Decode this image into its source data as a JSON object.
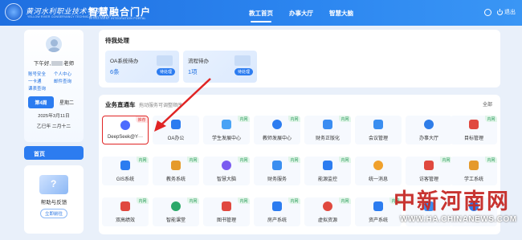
{
  "header": {
    "school_name": "黄河水利职业技术学院",
    "school_name_en": "YELLOW RIVER CONSERVANCY TECHNICAL INSTITUTE",
    "portal_title": "智慧融合门户",
    "portal_subtitle": "INTELLIGENT INTEGRATION PORTAL",
    "tabs": [
      "教工首页",
      "办事大厅",
      "智慧大脑"
    ],
    "active_tab": "教工首页",
    "logout_label": "退出"
  },
  "profile": {
    "greeting_prefix": "下午好,",
    "greeting_suffix": "老师",
    "quick_links": [
      "账号安全",
      "个人中心",
      "一卡通",
      "邮件查询",
      "课表查询"
    ],
    "week_tabs": [
      "第4周",
      "星期二"
    ],
    "date": "2025年3月11日",
    "lunar_date": "乙巳年 二月十二",
    "home_label": "首页"
  },
  "help": {
    "title": "帮助与反馈",
    "button": "立即前往"
  },
  "pending": {
    "title": "待我处理",
    "cards": [
      {
        "name": "OA系统待办",
        "count": "6条",
        "button": "待处理"
      },
      {
        "name": "流程待办",
        "count": "1项",
        "button": "待处理"
      }
    ]
  },
  "services": {
    "title": "业务直通车",
    "hint": "拖动服务可调整顺序",
    "view_all": "全部",
    "rows": [
      [
        {
          "label": "DeepSeek@Y···",
          "badge": "推荐",
          "icon": "deepseek-icon",
          "color": "#4d6bfe",
          "highlight": true
        },
        {
          "label": "OA办公",
          "badge": "",
          "icon": "oa-icon",
          "color": "#2c7cf0"
        },
        {
          "label": "学生发展中心",
          "badge": "内网",
          "icon": "student-dev-icon",
          "color": "#4aa3f5"
        },
        {
          "label": "教师发展中心",
          "badge": "内网",
          "icon": "teacher-dev-icon",
          "color": "#2c7cf0"
        },
        {
          "label": "财务正版化",
          "badge": "内网",
          "icon": "finance-license-icon",
          "color": "#3b8df2"
        },
        {
          "label": "会议管理",
          "badge": "",
          "icon": "meeting-icon",
          "color": "#3a8ef0"
        },
        {
          "label": "办事大厅",
          "badge": "",
          "icon": "service-hall-icon",
          "color": "#2f7de8"
        },
        {
          "label": "目标管理",
          "badge": "内网",
          "icon": "target-icon",
          "color": "#e0493f"
        }
      ],
      [
        {
          "label": "GIS系统",
          "badge": "内网",
          "icon": "gis-icon",
          "color": "#2c7cf0"
        },
        {
          "label": "教务系统",
          "badge": "内网",
          "icon": "academic-icon",
          "color": "#e59a2c"
        },
        {
          "label": "智慧大脑",
          "badge": "内网",
          "icon": "brain-icon",
          "color": "#7b5cf0"
        },
        {
          "label": "财务服务",
          "badge": "内网",
          "icon": "finance-icon",
          "color": "#3a8ef0"
        },
        {
          "label": "能源监控",
          "badge": "内网",
          "icon": "energy-icon",
          "color": "#2c7cf0"
        },
        {
          "label": "统一消息",
          "badge": "",
          "icon": "message-icon",
          "color": "#f0a12c"
        },
        {
          "label": "访客管理",
          "badge": "内网",
          "icon": "visitor-icon",
          "color": "#e0493f"
        },
        {
          "label": "学工系统",
          "badge": "内网",
          "icon": "student-affairs-icon",
          "color": "#e59a2c"
        }
      ],
      [
        {
          "label": "双高绩效",
          "badge": "内网",
          "icon": "performance-icon",
          "color": "#e0493f"
        },
        {
          "label": "智能课堂",
          "badge": "内网",
          "icon": "classroom-icon",
          "color": "#2ca86a"
        },
        {
          "label": "图书管理",
          "badge": "内网",
          "icon": "library-icon",
          "color": "#e0493f"
        },
        {
          "label": "房产系统",
          "badge": "内网",
          "icon": "property-icon",
          "color": "#2c7cf0"
        },
        {
          "label": "虚拟资源",
          "badge": "内网",
          "icon": "virtual-resource-icon",
          "color": "#e0493f"
        },
        {
          "label": "资产系统",
          "badge": "内网",
          "icon": "asset-icon",
          "color": "#2c7cf0"
        },
        {
          "label": "",
          "badge": "",
          "icon": "app-icon",
          "color": "#3a8ef0"
        },
        {
          "label": "",
          "badge": "",
          "icon": "app-icon",
          "color": "#2c7cf0"
        }
      ]
    ]
  },
  "watermark": {
    "text": "中新河南网",
    "url": "WWW.HA.CHINANEWS.COM"
  },
  "colors": {
    "primary": "#2c7cf0",
    "highlight_border": "#e02424",
    "arrow": "#e02424"
  }
}
